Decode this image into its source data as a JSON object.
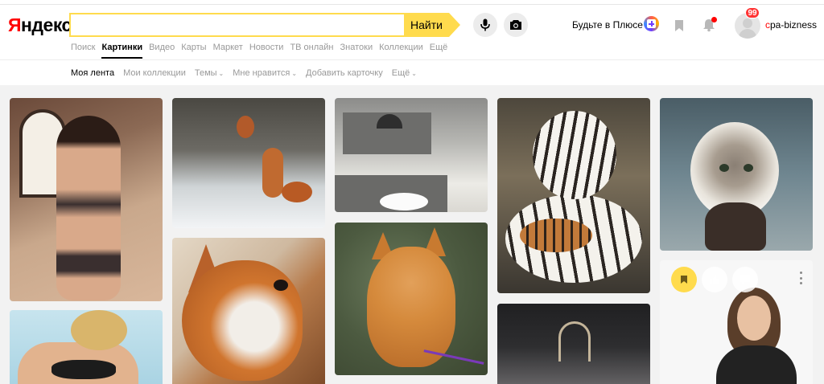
{
  "logo": {
    "first": "Я",
    "rest": "ндекс"
  },
  "search": {
    "value": "",
    "placeholder": "",
    "submit_label": "Найти"
  },
  "header": {
    "plus_text": "Будьте в Плюсе",
    "notifications_count": "99",
    "username_first": "c",
    "username_rest": "pa-bizness",
    "colors": {
      "accent": "#ffdb4d",
      "brand_red": "#ff0000"
    }
  },
  "services": [
    {
      "label": "Поиск",
      "active": false
    },
    {
      "label": "Картинки",
      "active": true
    },
    {
      "label": "Видео",
      "active": false
    },
    {
      "label": "Карты",
      "active": false
    },
    {
      "label": "Маркет",
      "active": false
    },
    {
      "label": "Новости",
      "active": false
    },
    {
      "label": "ТВ онлайн",
      "active": false
    },
    {
      "label": "Знатоки",
      "active": false
    },
    {
      "label": "Коллекции",
      "active": false
    },
    {
      "label": "Ещё",
      "active": false
    }
  ],
  "subnav": [
    {
      "label": "Моя лента",
      "active": true,
      "dropdown": false
    },
    {
      "label": "Мои коллекции",
      "active": false,
      "dropdown": false
    },
    {
      "label": "Темы",
      "active": false,
      "dropdown": true
    },
    {
      "label": "Мне нравится",
      "active": false,
      "dropdown": true
    },
    {
      "label": "Добавить карточку",
      "active": false,
      "dropdown": false
    },
    {
      "label": "Ещё",
      "active": false,
      "dropdown": true
    }
  ],
  "icons": {
    "mic": "microphone-icon",
    "camera": "camera-icon",
    "plus": "plus-icon",
    "bookmark": "bookmark-icon",
    "bell": "bell-icon",
    "save": "bookmark-icon",
    "like": "thumbs-up-icon",
    "comment": "comment-icon",
    "more": "more-vertical-icon"
  },
  "feed": {
    "cards": [
      {
        "subject": "woman-in-lingerie"
      },
      {
        "subject": "woman-in-bikini"
      },
      {
        "subject": "squirrels-in-snow"
      },
      {
        "subject": "fox"
      },
      {
        "subject": "grey-kitchen"
      },
      {
        "subject": "ginger-kitten"
      },
      {
        "subject": "white-tiger-with-cubs"
      },
      {
        "subject": "handbag"
      },
      {
        "subject": "fluffy-kitten"
      },
      {
        "subject": "woman-in-black-sweater",
        "hovered": true
      }
    ]
  }
}
